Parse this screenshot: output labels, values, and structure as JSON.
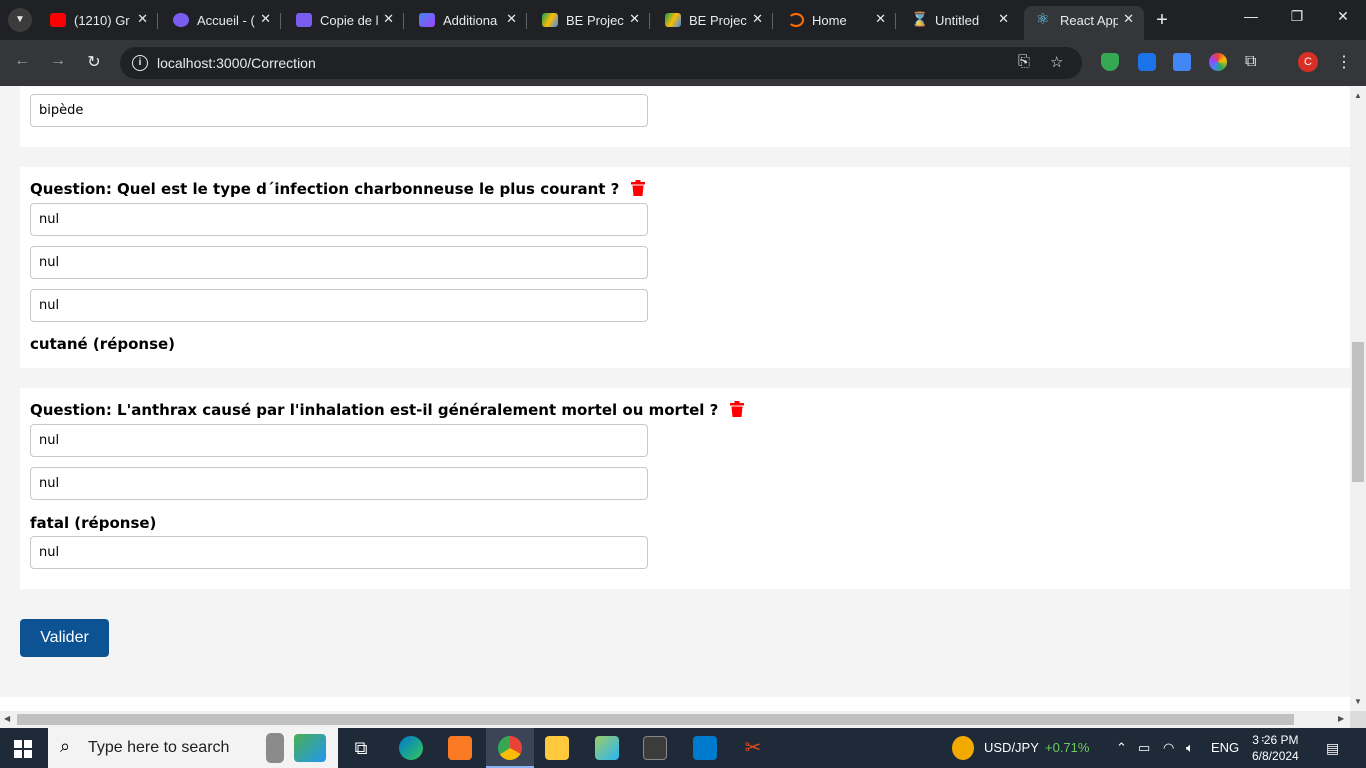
{
  "browser": {
    "tabs": [
      {
        "title": "(1210) Gr",
        "favicon_color": "#ff0000",
        "icon": "youtube-icon"
      },
      {
        "title": "Accueil - (",
        "favicon_color": "#7b5cf0",
        "icon": "canva-icon"
      },
      {
        "title": "Copie de l",
        "favicon_color": "#7b5cf0",
        "icon": "canva-icon"
      },
      {
        "title": "Additiona",
        "favicon_color": "#6a5cf0",
        "icon": "app-icon"
      },
      {
        "title": "BE Project",
        "favicon_color": "#fbbc04",
        "icon": "google-drive-icon"
      },
      {
        "title": "BE Project",
        "favicon_color": "#fbbc04",
        "icon": "google-drive-icon"
      },
      {
        "title": "Home",
        "favicon_color": "#ff6d00",
        "icon": "loading-icon"
      },
      {
        "title": "Untitled",
        "favicon_color": "#f29900",
        "icon": "hourglass-icon"
      },
      {
        "title": "React App",
        "favicon_color": "#61dafb",
        "icon": "react-icon"
      }
    ],
    "url": "localhost:3000/Correction",
    "profile_initial": "C"
  },
  "page": {
    "prev_answer_value": "bipède",
    "questions": [
      {
        "title": "Question: Quel est le type d´infection charbonneuse le plus courant ?",
        "answers": [
          "nul",
          "nul",
          "nul"
        ],
        "correct_label": "cutané (réponse)"
      },
      {
        "title": "Question: L'anthrax causé par l'inhalation est-il généralement mortel ou mortel ?",
        "answers_before": [
          "nul",
          "nul"
        ],
        "correct_label": "fatal (réponse)",
        "answers_after": [
          "nul"
        ]
      }
    ],
    "submit_label": "Valider",
    "trash_color": "#ff0000",
    "submit_color": "#0d5393"
  },
  "taskbar": {
    "search_placeholder": "Type here to search",
    "ticker_symbol": "USD/JPY",
    "ticker_change": "+0.71%",
    "language": "ENG",
    "time": "3᠄26 PM",
    "date": "6/8/2024"
  }
}
